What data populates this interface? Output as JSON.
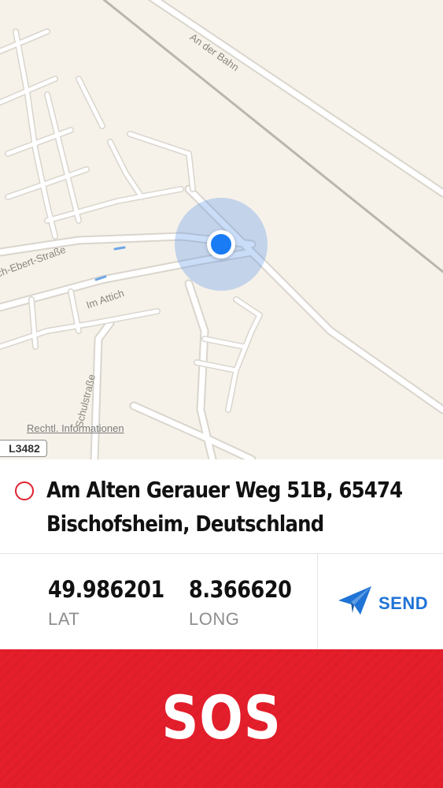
{
  "map": {
    "streets": {
      "an_der_bahn": "An der Bahn",
      "ebert_strasse": "ch-Ebert-Straße",
      "im_attich": "Im Attich",
      "schulstrasse": "Schulstraße"
    },
    "legal_link": "Rechtl. Informationen",
    "route_shield": "L3482"
  },
  "address": {
    "text": "Am Alten Gerauer Weg 51B, 65474 Bischofsheim, Deutschland"
  },
  "coordinates": {
    "lat_value": "49.986201",
    "lat_label": "LAT",
    "long_value": "8.366620",
    "long_label": "LONG"
  },
  "send": {
    "label": "SEND",
    "icon": "paper-plane-icon"
  },
  "sos": {
    "label": "SOS"
  },
  "colors": {
    "map_background": "#f6f2ea",
    "location_dot": "#1a7cf5",
    "sos_red": "#e41e2b",
    "send_blue": "#1f73d6"
  }
}
